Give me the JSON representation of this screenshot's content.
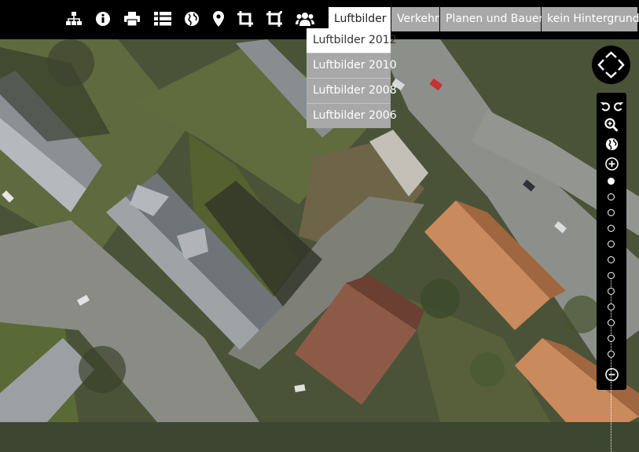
{
  "toolbar": {
    "tools": [
      {
        "name": "sitemap-icon"
      },
      {
        "name": "info-icon"
      },
      {
        "name": "print-icon"
      },
      {
        "name": "list-icon"
      },
      {
        "name": "globe-icon"
      },
      {
        "name": "map-marker-icon"
      },
      {
        "name": "crop-icon"
      },
      {
        "name": "crop-alt-icon"
      },
      {
        "name": "users-icon"
      }
    ],
    "layers": [
      {
        "label": "Luftbilder",
        "active": true
      },
      {
        "label": "Verkehr",
        "active": false
      },
      {
        "label": "Planen und Bauen",
        "active": false
      },
      {
        "label": "kein Hintergrund",
        "active": false
      }
    ]
  },
  "dropdown": {
    "items": [
      "Luftbilder 2012",
      "Luftbilder 2010",
      "Luftbilder 2008",
      "Luftbilder 2006"
    ],
    "selected": "Luftbilder 2012"
  },
  "controls": {
    "pan": "pan-arrows-icon",
    "icons": [
      "undo-icon",
      "redo-icon",
      "zoom-search-icon",
      "globe-icon",
      "zoom-in-icon",
      "zoom-out-icon"
    ],
    "zoom_levels": 12,
    "zoom_current_index": 0
  },
  "colors": {
    "toolbar_bg": "#000000",
    "inactive_button": "#a8a8a8",
    "active_button": "#ffffff",
    "roof_orange": "#c98a5e",
    "roof_brown": "#8e5a48"
  }
}
